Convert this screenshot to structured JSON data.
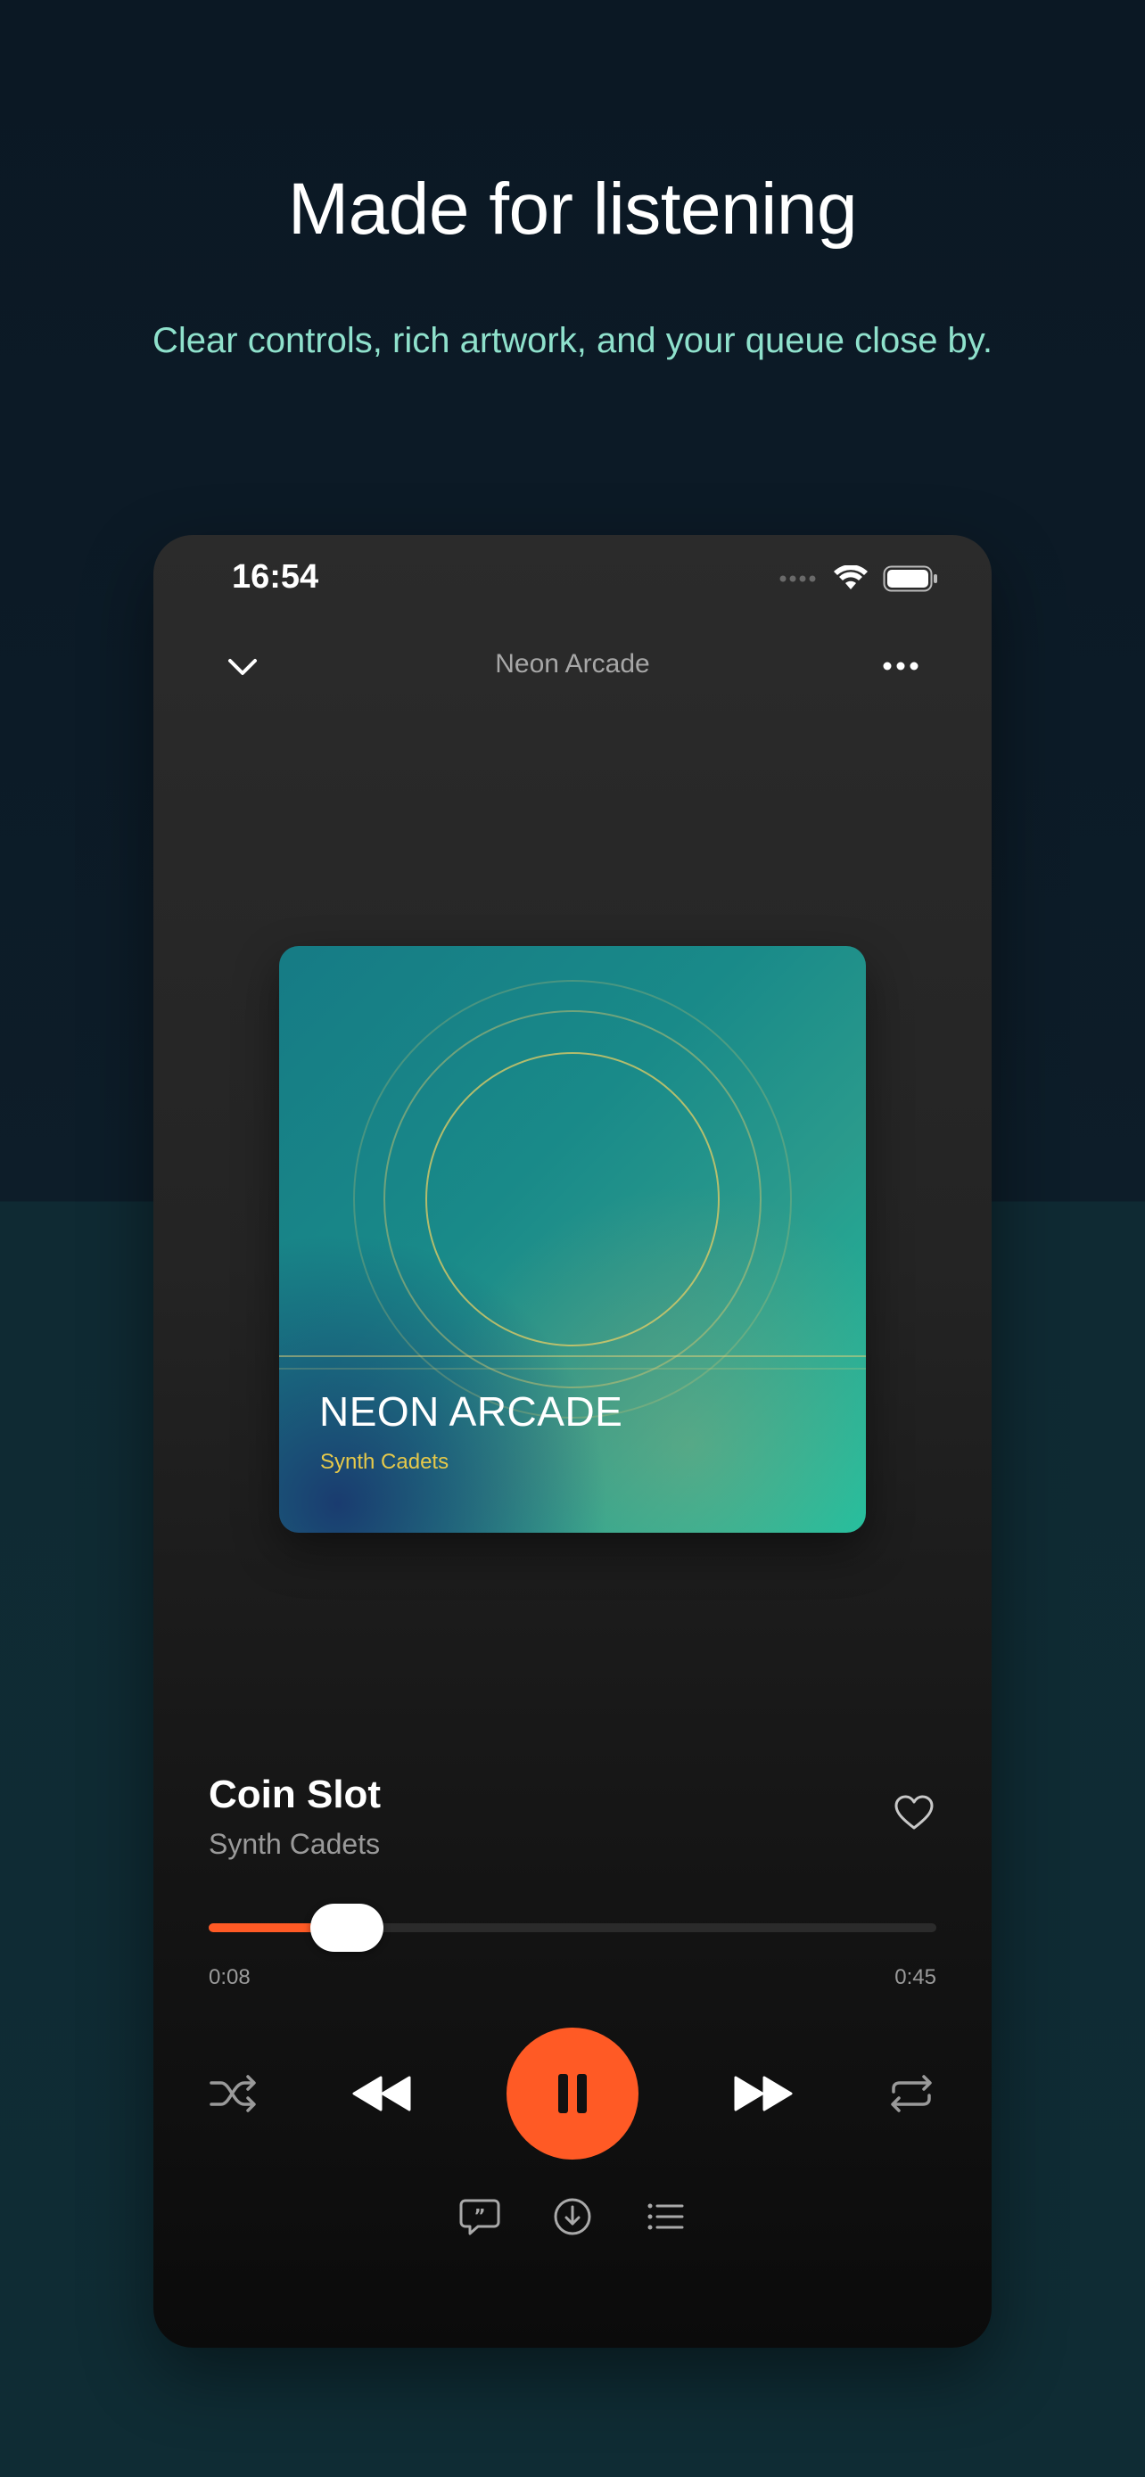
{
  "hero": {
    "title": "Made for listening",
    "subtitle": "Clear controls, rich artwork, and your queue close by."
  },
  "status_bar": {
    "time": "16:54",
    "icons": [
      "signal-dots-icon",
      "wifi-icon",
      "battery-icon"
    ]
  },
  "nav": {
    "title": "Neon Arcade",
    "left_icon": "chevron-down-icon",
    "right_icon": "more-icon"
  },
  "artwork": {
    "title": "NEON ARCADE",
    "artist": "Synth Cadets"
  },
  "track": {
    "title": "Coin Slot",
    "artist": "Synth Cadets",
    "favorite_icon": "heart-icon"
  },
  "progress": {
    "current": "0:08",
    "total": "0:45",
    "fraction": 0.19
  },
  "controls": [
    "shuffle-icon",
    "rewind-icon",
    "pause-icon",
    "fast-forward-icon",
    "repeat-icon"
  ],
  "secondary_actions": [
    "lyrics-icon",
    "download-icon",
    "queue-icon"
  ],
  "colors": {
    "accent": "#ff5a25",
    "subtitle": "#8fe1cc",
    "art_artist": "#e6c94a"
  }
}
